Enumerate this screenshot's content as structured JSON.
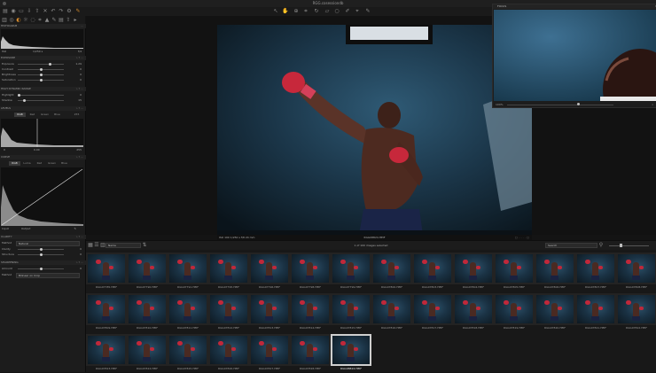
{
  "window": {
    "title": "RGG.cosessiondb"
  },
  "toolbar": {
    "icons": [
      "library-icon",
      "camera-icon",
      "folder-icon",
      "import-icon",
      "export-icon",
      "trash-icon",
      "undo-icon",
      "redo-icon",
      "settings-icon",
      "edit-icon"
    ]
  },
  "left_panel": {
    "histogram_header": "HISTOGRAM",
    "iso_row": {
      "label": "ISO",
      "value1": "1/250 s",
      "value2": "f/4"
    },
    "exposure_header": "EXPOSURE",
    "exposure_rows": [
      {
        "label": "Exposure",
        "value": "1.29"
      },
      {
        "label": "Contrast",
        "value": "0"
      },
      {
        "label": "Brightness",
        "value": "0"
      },
      {
        "label": "Saturation",
        "value": "0"
      }
    ],
    "hdr_header": "HIGH DYNAMIC RANGE",
    "hdr_rows": [
      {
        "label": "Highlight",
        "value": "0"
      },
      {
        "label": "Shadow",
        "value": "15"
      }
    ],
    "levels_header": "LEVELS",
    "levels_tabs": [
      "RGB",
      "Red",
      "Green",
      "Blue"
    ],
    "levels_value_top": "255",
    "levels_value_left": "0",
    "levels_value_mid": "0.00",
    "levels_value_right": "255",
    "curve_header": "CURVE",
    "curve_tabs": [
      "RGB",
      "Luma",
      "Red",
      "Green",
      "Blue"
    ],
    "curve_input": "Input",
    "curve_output": "Output",
    "clarity_header": "CLARITY",
    "clarity_method_label": "Method",
    "clarity_method_value": "Natural",
    "clarity_rows": [
      {
        "label": "Clarity",
        "value": "0"
      },
      {
        "label": "Structure",
        "value": "0"
      }
    ],
    "sharpen_header": "SHARPENING",
    "sharpen_amount_label": "Amount",
    "sharpen_amount_value": "0",
    "sharpen_method_label": "Method",
    "sharpen_method_value": "Bilinear on Crop"
  },
  "viewer": {
    "info_left": "ISO 100   1/250 s   f/8   24 mm",
    "filename": "RGG08824.HEIF"
  },
  "focus": {
    "title": "FOCUS",
    "zoom": "100%"
  },
  "browser": {
    "sort_label": "Name",
    "count_text": "1 of 100 images selected",
    "search_label": "Search",
    "thumbnails": [
      "RGG07785.HEIF",
      "RGG07790.HEIF",
      "RGG07791.HEIF",
      "RGG07795.HEIF",
      "RGG07796.HEIF",
      "RGG07798.HEIF",
      "RGG07799.HEIF",
      "RGG07800.HEIF",
      "RGG07803.HEIF",
      "RGG07804.HEIF",
      "RGG07805.HEIF",
      "RGG07806.HEIF",
      "RGG07807.HEIF",
      "RGG07808.HEIF",
      "RGG07809.HEIF",
      "RGG07810.HEIF",
      "RGG07811.HEIF",
      "RGG07812.HEIF",
      "RGG07813.HEIF",
      "RGG07814.HEIF",
      "RGG07815.HEIF",
      "RGG07816.HEIF",
      "RGG07817.HEIF",
      "RGG07818.HEIF",
      "RGG07819.HEIF",
      "RGG07820.HEIF",
      "RGG07821.HEIF",
      "RGG07822.HEIF",
      "RGG07823.HEIF",
      "RGG07824.HEIF",
      "RGG07825.HEIF",
      "RGG07826.HEIF",
      "RGG07827.HEIF",
      "RGG07828.HEIF",
      "RGG08824.HEIF"
    ],
    "selected_index": 34
  },
  "colors": {
    "accent": "#4a7ec0",
    "glove": "#c0283a",
    "background": "#141414"
  }
}
